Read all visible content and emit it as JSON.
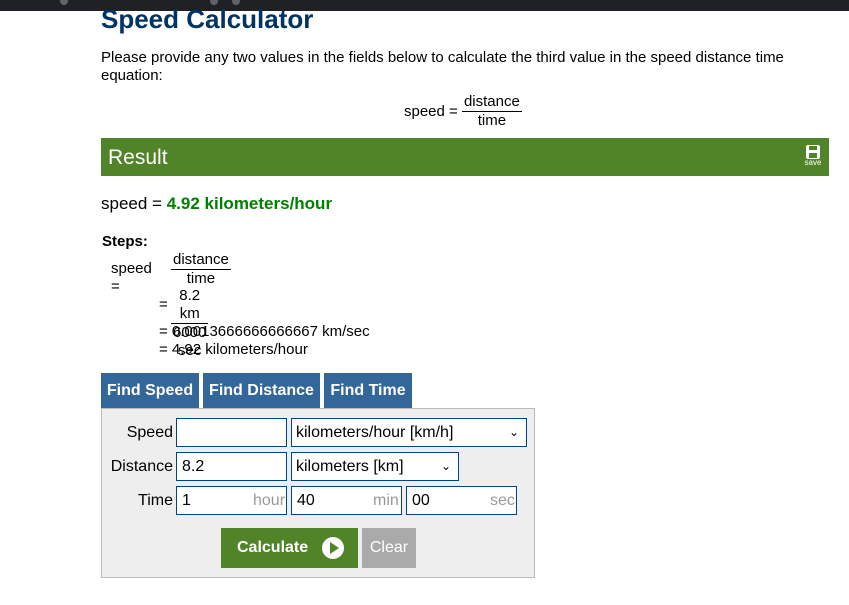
{
  "page": {
    "title": "Speed Calculator",
    "intro": "Please provide any two values in the fields below to calculate the third value in the speed distance time equation:"
  },
  "formula": {
    "lhs": "speed =",
    "numerator": "distance",
    "denominator": "time"
  },
  "result": {
    "header": "Result",
    "save_label": "save",
    "answer_prefix": "speed =",
    "answer_value": "4.92 kilometers/hour"
  },
  "steps": {
    "title": "Steps:",
    "line1_lhs": "speed =",
    "line1_num": "distance",
    "line1_den": "time",
    "line2_eq": "=",
    "line2_num": "8.2 km",
    "line2_den": "6000 sec",
    "line3": "= 0.0013666666666667 km/sec",
    "line4": "= 4.92 kilometers/hour"
  },
  "tabs": [
    "Find Speed",
    "Find Distance",
    "Find Time"
  ],
  "form": {
    "speed_label": "Speed",
    "speed_value": "",
    "speed_unit": "kilometers/hour [km/h]",
    "distance_label": "Distance",
    "distance_value": "8.2",
    "distance_unit": "kilometers [km]",
    "time_label": "Time",
    "time_hour": "1",
    "time_hour_suffix": "hour",
    "time_min": "40",
    "time_min_suffix": "min",
    "time_sec": "00",
    "time_sec_suffix": "sec"
  },
  "buttons": {
    "calculate": "Calculate",
    "clear": "Clear"
  },
  "colors": {
    "title": "#003366",
    "result_bar": "#518428",
    "answer": "#008000",
    "tab": "#336699",
    "clear": "#aaaaaa"
  },
  "icons": [
    "save-icon",
    "play-icon",
    "chevron-down-icon"
  ]
}
